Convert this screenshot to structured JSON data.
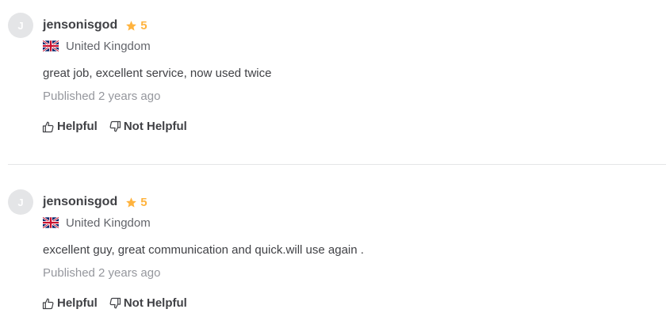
{
  "colors": {
    "star": "#ffb33e",
    "avatar_bg": "#e4e5e7",
    "divider": "#e4e5e7",
    "muted_text": "#95979d"
  },
  "reviews": [
    {
      "avatar_initial": "J",
      "username": "jensonisgod",
      "rating": "5",
      "rating_icon": "star-icon",
      "flag_icon": "uk-flag-icon",
      "country": "United Kingdom",
      "text": "great job, excellent service, now used twice",
      "published": "Published 2 years ago",
      "helpful_label": "Helpful",
      "not_helpful_label": "Not Helpful"
    },
    {
      "avatar_initial": "J",
      "username": "jensonisgod",
      "rating": "5",
      "rating_icon": "star-icon",
      "flag_icon": "uk-flag-icon",
      "country": "United Kingdom",
      "text": "excellent guy, great communication and quick.will use again .",
      "published": "Published 2 years ago",
      "helpful_label": "Helpful",
      "not_helpful_label": "Not Helpful"
    }
  ]
}
